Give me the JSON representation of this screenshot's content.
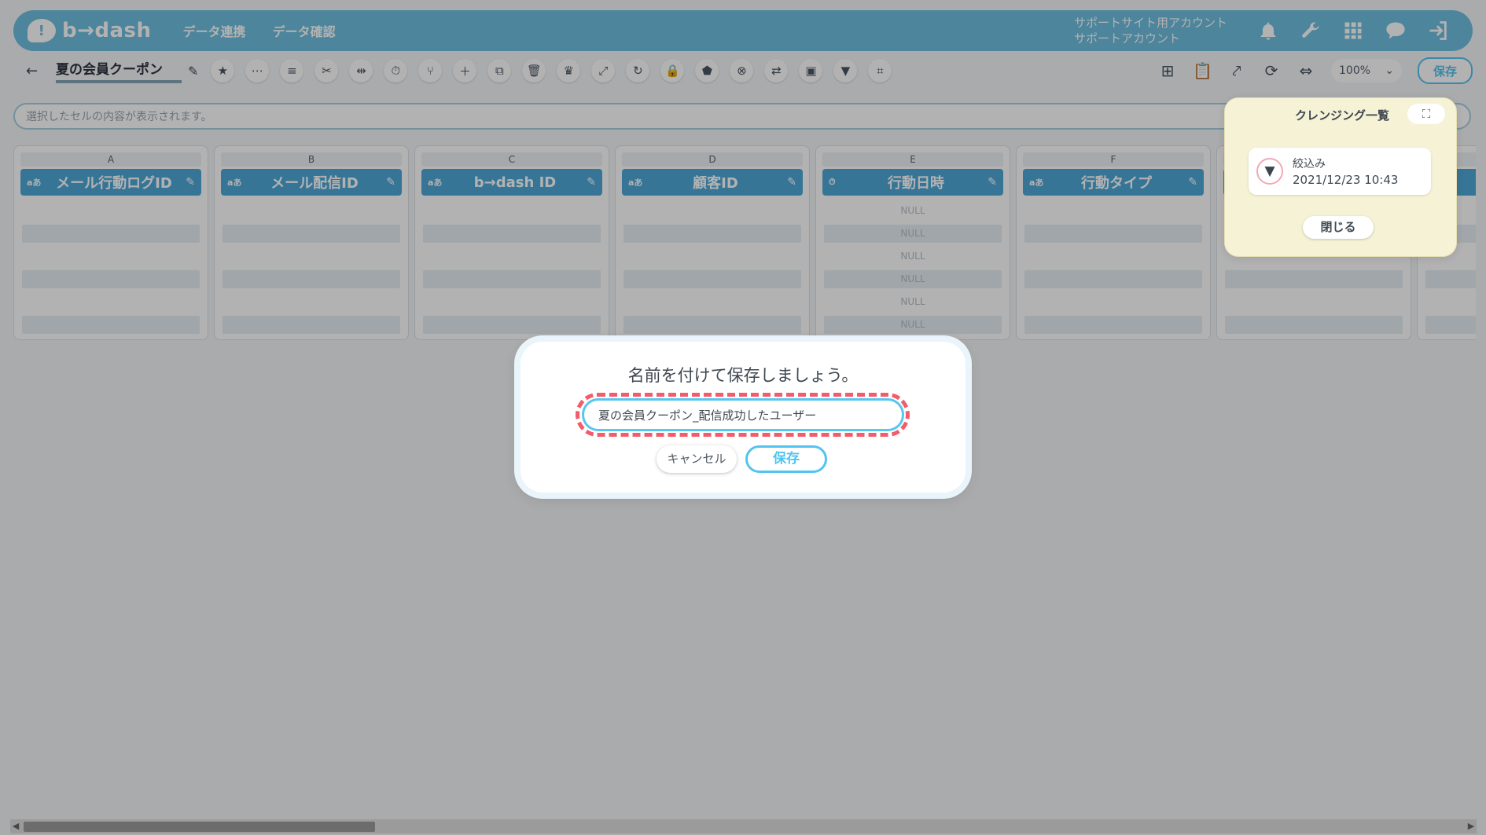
{
  "header": {
    "logo_text": "b→dash",
    "nav": [
      "データ連携",
      "データ確認"
    ],
    "account_line1": "サポートサイト用アカウント",
    "account_line2": "サポートアカウント"
  },
  "toolbar": {
    "back_icon": "←",
    "title": "夏の会員クーポン",
    "zoom": "100%",
    "save_label": "保存"
  },
  "cell_display": {
    "placeholder": "選択したセルの内容が表示されます。"
  },
  "columns": [
    {
      "letter": "A",
      "type": "aあ",
      "label": "メール行動ログID"
    },
    {
      "letter": "B",
      "type": "aあ",
      "label": "メール配信ID"
    },
    {
      "letter": "C",
      "type": "aあ",
      "label": "b→dash ID"
    },
    {
      "letter": "D",
      "type": "aあ",
      "label": "顧客ID"
    },
    {
      "letter": "E",
      "type": "⏱",
      "label": "行動日時",
      "null_text": "NULL"
    },
    {
      "letter": "F",
      "type": "aあ",
      "label": "行動タイプ"
    }
  ],
  "cleansing": {
    "title": "クレンジング一覧",
    "expand_icon": "⛶",
    "item_name": "絞込み",
    "item_date": "2021/12/23 10:43",
    "close_label": "閉じる"
  },
  "dialog": {
    "title": "名前を付けて保存しましょう。",
    "input_value": "夏の会員クーポン_配信成功したユーザー",
    "cancel_label": "キャンセル",
    "save_label": "保存"
  },
  "colors": {
    "brand": "#6fbfe0",
    "column_header": "#4fa8d8",
    "highlight": "#f25c6b",
    "save_accent": "#52c4ef"
  }
}
